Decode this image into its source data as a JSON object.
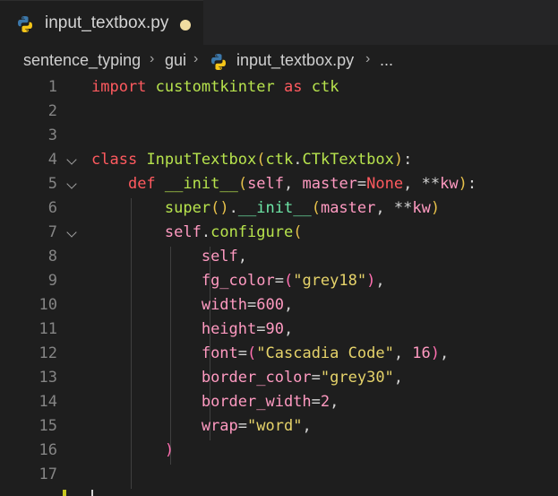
{
  "tab": {
    "file_name": "input_textbox.py",
    "icon": "python-icon",
    "dirty_color": "#f0dca0"
  },
  "breadcrumb": {
    "folder1": "sentence_typing",
    "folder2": "gui",
    "file": "input_textbox.py",
    "symbol": "..."
  },
  "editor": {
    "lines": [
      {
        "n": "1",
        "code": "import customtkinter as ctk"
      },
      {
        "n": "2",
        "code": ""
      },
      {
        "n": "3",
        "code": ""
      },
      {
        "n": "4",
        "code": "class InputTextbox(ctk.CTkTextbox):"
      },
      {
        "n": "5",
        "code": "    def __init__(self, master=None, **kw):"
      },
      {
        "n": "6",
        "code": "        super().__init__(master, **kw)"
      },
      {
        "n": "7",
        "code": "        self.configure("
      },
      {
        "n": "8",
        "code": "            self,"
      },
      {
        "n": "9",
        "code": "            fg_color=(\"grey18\"),"
      },
      {
        "n": "10",
        "code": "            width=600,"
      },
      {
        "n": "11",
        "code": "            height=90,"
      },
      {
        "n": "12",
        "code": "            font=(\"Cascadia Code\", 16),"
      },
      {
        "n": "13",
        "code": "            border_color=\"grey30\","
      },
      {
        "n": "14",
        "code": "            border_width=2,"
      },
      {
        "n": "15",
        "code": "            wrap=\"word\","
      },
      {
        "n": "16",
        "code": "        )"
      },
      {
        "n": "17",
        "code": ""
      }
    ]
  }
}
